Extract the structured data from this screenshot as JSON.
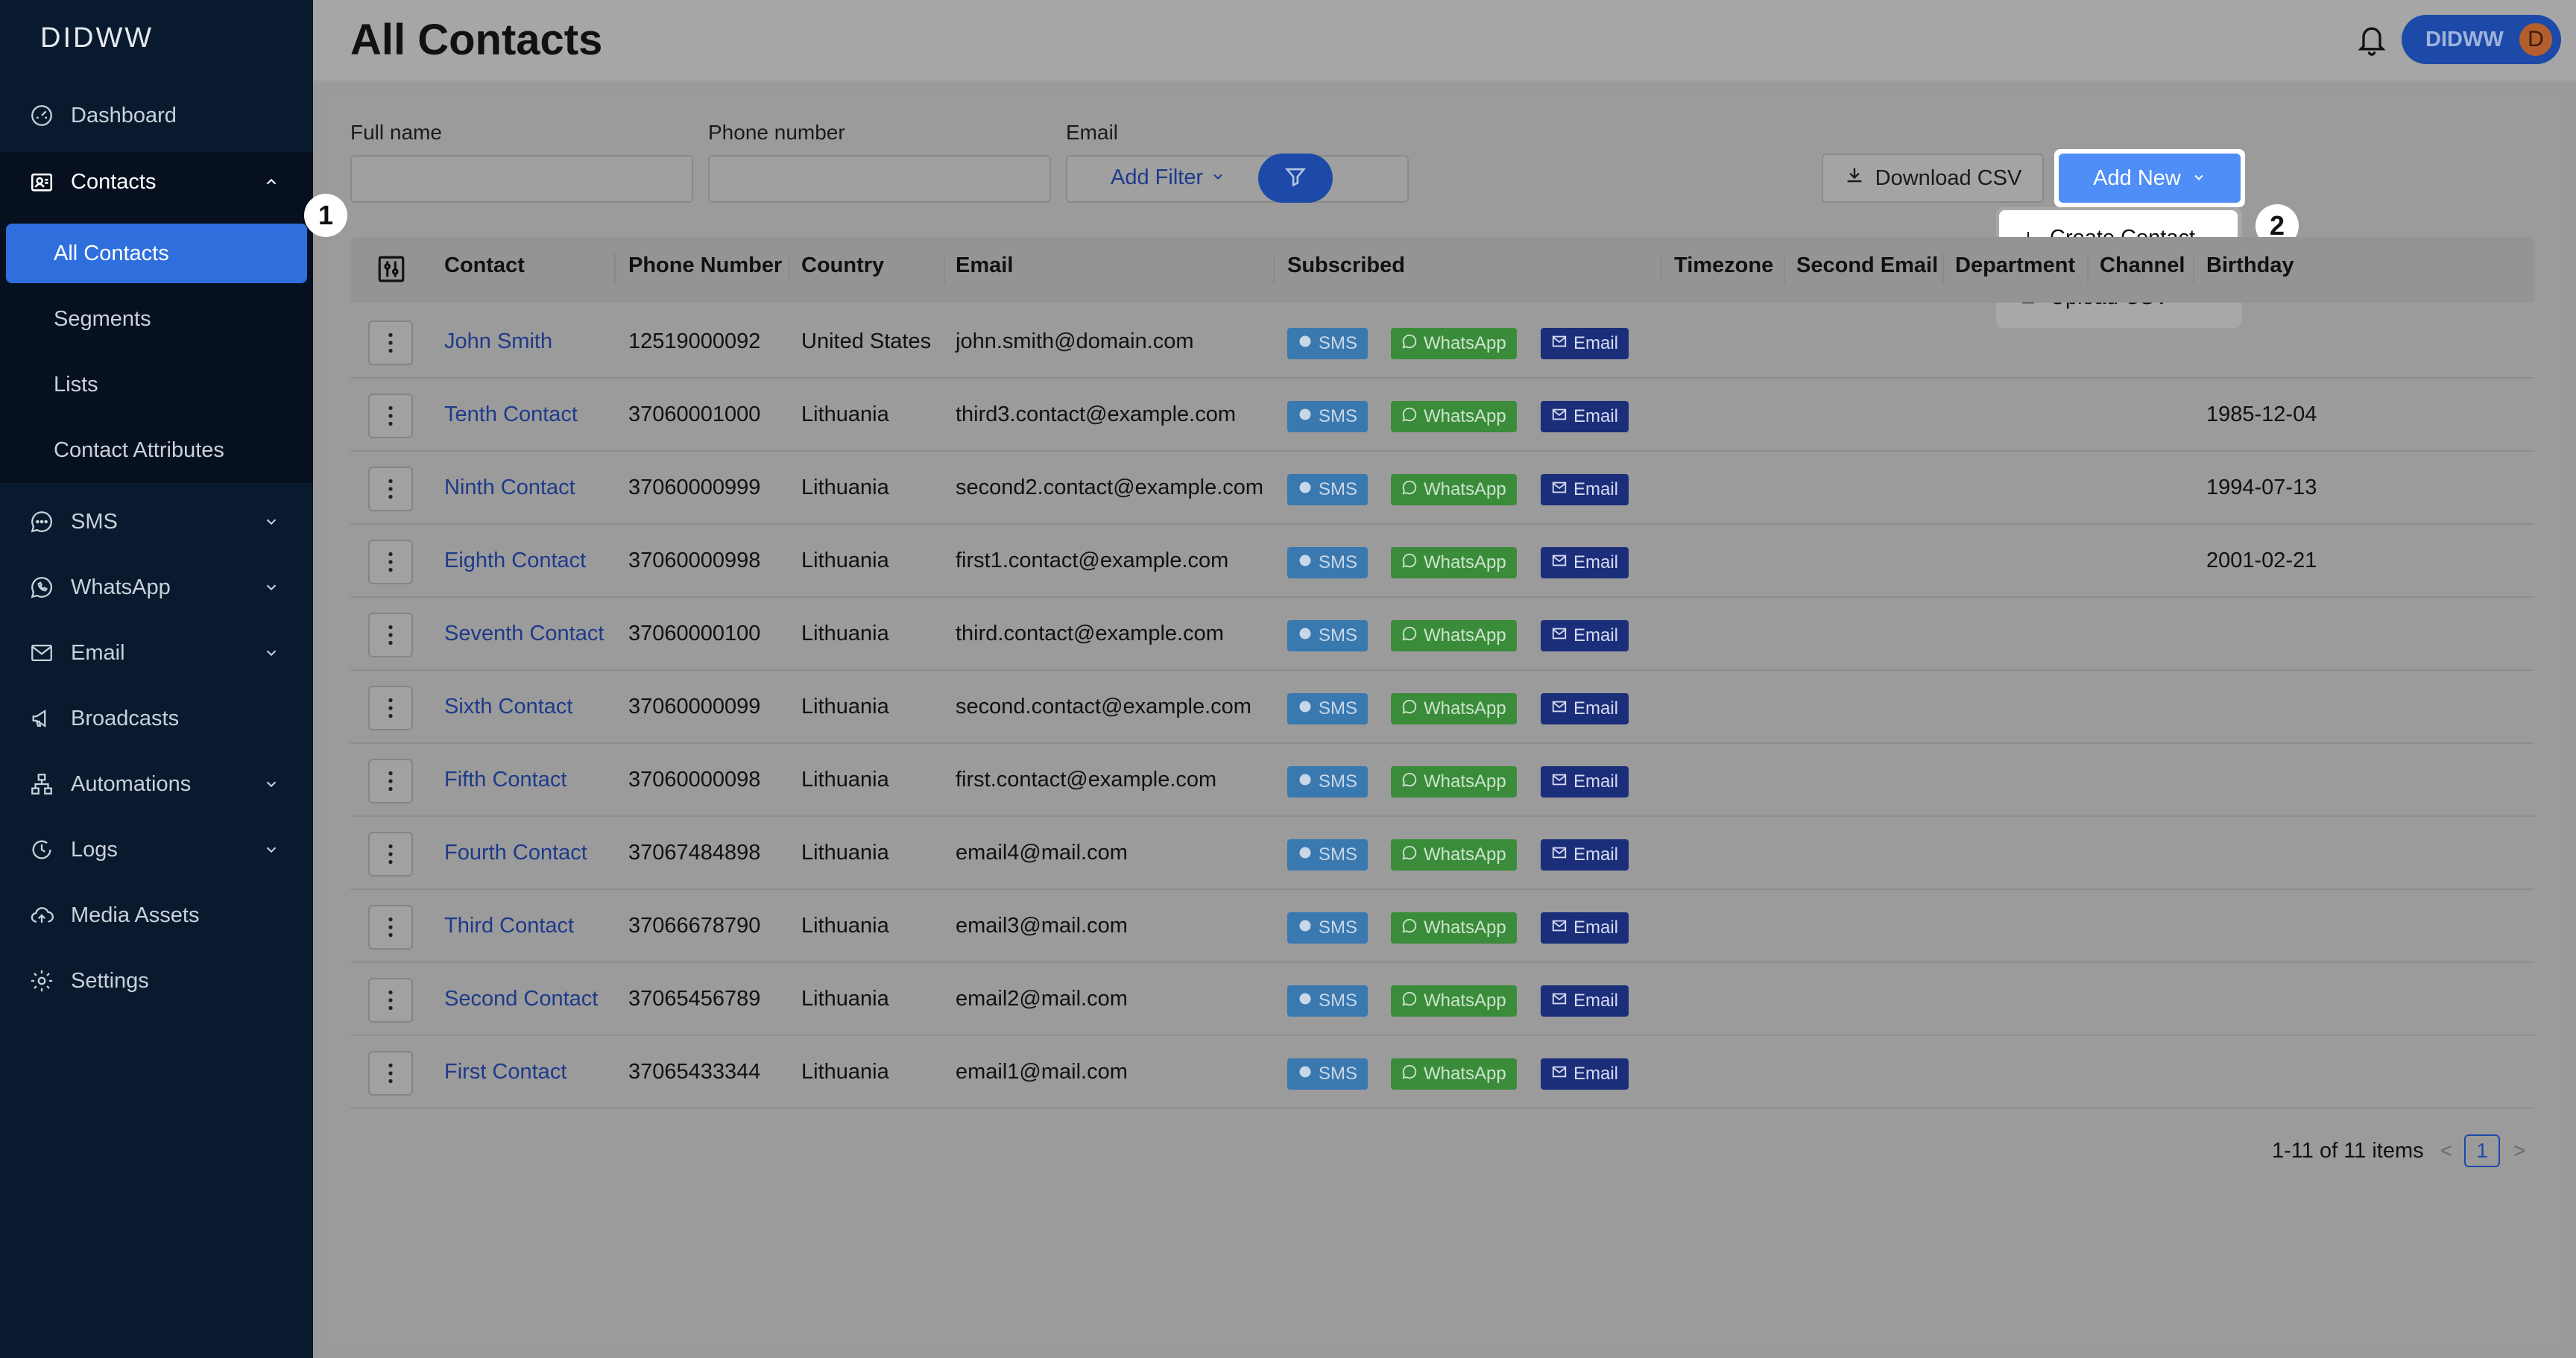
{
  "app": {
    "logo": "DIDWW"
  },
  "sidebar": {
    "items": [
      {
        "label": "Dashboard",
        "icon": "dashboard-icon"
      },
      {
        "label": "Contacts",
        "icon": "contacts-icon",
        "expanded": true
      },
      {
        "label": "SMS",
        "icon": "sms-icon"
      },
      {
        "label": "WhatsApp",
        "icon": "whatsapp-icon"
      },
      {
        "label": "Email",
        "icon": "email-icon"
      },
      {
        "label": "Broadcasts",
        "icon": "megaphone-icon"
      },
      {
        "label": "Automations",
        "icon": "automations-icon"
      },
      {
        "label": "Logs",
        "icon": "logs-icon"
      },
      {
        "label": "Media Assets",
        "icon": "cloud-upload-icon"
      },
      {
        "label": "Settings",
        "icon": "gear-icon"
      }
    ],
    "contacts_submenu": [
      {
        "label": "All Contacts",
        "active": true
      },
      {
        "label": "Segments"
      },
      {
        "label": "Lists"
      },
      {
        "label": "Contact Attributes"
      }
    ]
  },
  "header": {
    "title": "All Contacts",
    "user_name": "DIDWW",
    "user_initial": "D"
  },
  "filters": {
    "full_name_label": "Full name",
    "phone_label": "Phone number",
    "email_label": "Email",
    "full_name_value": "",
    "phone_value": "",
    "email_value": "",
    "add_filter": "Add Filter"
  },
  "actions": {
    "download_csv": "Download CSV",
    "add_new": "Add New",
    "menu": [
      {
        "label": "Create Contact",
        "icon": "plus-icon"
      },
      {
        "label": "Upload CSV",
        "icon": "upload-icon"
      }
    ]
  },
  "annotations": {
    "one": "1",
    "two": "2"
  },
  "table": {
    "columns": [
      "Contact",
      "Phone Number",
      "Country",
      "Email",
      "Subscribed",
      "Timezone",
      "Second Email",
      "Department",
      "Channel",
      "Birthday"
    ],
    "chip_labels": {
      "sms": "SMS",
      "whatsapp": "WhatsApp",
      "email": "Email"
    },
    "rows": [
      {
        "name": "John Smith",
        "phone": "12519000092",
        "country": "United States",
        "email": "john.smith@domain.com",
        "birthday": ""
      },
      {
        "name": "Tenth Contact",
        "phone": "37060001000",
        "country": "Lithuania",
        "email": "third3.contact@example.com",
        "birthday": "1985-12-04"
      },
      {
        "name": "Ninth Contact",
        "phone": "37060000999",
        "country": "Lithuania",
        "email": "second2.contact@example.com",
        "birthday": "1994-07-13"
      },
      {
        "name": "Eighth Contact",
        "phone": "37060000998",
        "country": "Lithuania",
        "email": "first1.contact@example.com",
        "birthday": "2001-02-21"
      },
      {
        "name": "Seventh Contact",
        "phone": "37060000100",
        "country": "Lithuania",
        "email": "third.contact@example.com",
        "birthday": ""
      },
      {
        "name": "Sixth Contact",
        "phone": "37060000099",
        "country": "Lithuania",
        "email": "second.contact@example.com",
        "birthday": ""
      },
      {
        "name": "Fifth Contact",
        "phone": "37060000098",
        "country": "Lithuania",
        "email": "first.contact@example.com",
        "birthday": ""
      },
      {
        "name": "Fourth Contact",
        "phone": "37067484898",
        "country": "Lithuania",
        "email": "email4@mail.com",
        "birthday": ""
      },
      {
        "name": "Third Contact",
        "phone": "37066678790",
        "country": "Lithuania",
        "email": "email3@mail.com",
        "birthday": ""
      },
      {
        "name": "Second Contact",
        "phone": "37065456789",
        "country": "Lithuania",
        "email": "email2@mail.com",
        "birthday": ""
      },
      {
        "name": "First Contact",
        "phone": "37065433344",
        "country": "Lithuania",
        "email": "email1@mail.com",
        "birthday": ""
      }
    ]
  },
  "pagination": {
    "info": "1-11 of 11 items",
    "current": "1",
    "prev": "<",
    "next": ">"
  }
}
